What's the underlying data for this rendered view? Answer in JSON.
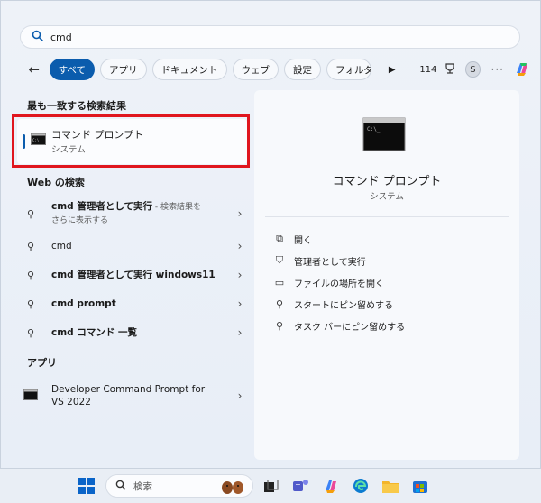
{
  "search": {
    "value": "cmd"
  },
  "filters": {
    "chips": [
      "すべて",
      "アプリ",
      "ドキュメント",
      "ウェブ",
      "設定",
      "フォルダー"
    ],
    "points": "114",
    "avatar_letter": "S"
  },
  "best_match": {
    "heading": "最も一致する検索結果",
    "title": "コマンド プロンプト",
    "subtitle": "システム"
  },
  "web": {
    "heading": "Web の検索",
    "items": [
      {
        "bold": "cmd 管理者として実行",
        "hint": " - 検索結果を",
        "line2": "さらに表示する"
      },
      {
        "text": "cmd"
      },
      {
        "bold": "cmd 管理者として実行 windows11"
      },
      {
        "bold": "cmd prompt"
      },
      {
        "bold": "cmd コマンド 一覧"
      }
    ]
  },
  "apps": {
    "heading": "アプリ",
    "items": [
      {
        "line1": "Developer Command Prompt for",
        "line2": "VS 2022"
      }
    ]
  },
  "detail": {
    "title": "コマンド プロンプト",
    "subtitle": "システム",
    "actions": [
      "開く",
      "管理者として実行",
      "ファイルの場所を開く",
      "スタートにピン留めする",
      "タスク バーにピン留めする"
    ]
  },
  "taskbar": {
    "search_placeholder": "検索"
  },
  "colors": {
    "accent": "#0b5cad",
    "highlight_box": "#e0161e"
  }
}
